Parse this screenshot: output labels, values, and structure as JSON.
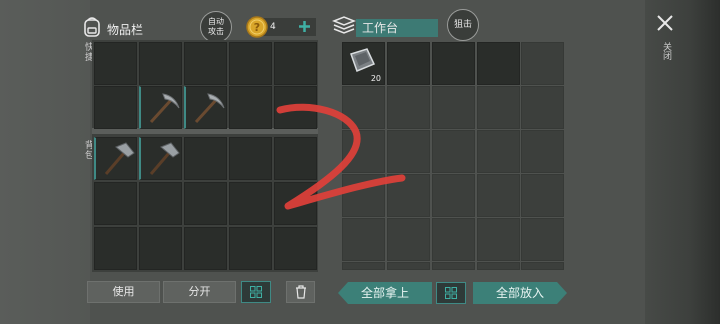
{
  "inventory": {
    "title": "物品栏",
    "auto_attack": [
      "自动",
      "攻击"
    ],
    "coins": "4",
    "quick_bar_label": "快捷",
    "backpack_label": "背包"
  },
  "workbench": {
    "title": "工作台",
    "snipe_button": "狙击",
    "close_label": "关闭",
    "slot_items": [
      {
        "name": "iron-plate",
        "count": "20"
      }
    ]
  },
  "items": {
    "quick_bar": [
      "pickaxe",
      "pickaxe"
    ],
    "backpack": [
      "hammer",
      "hammer"
    ]
  },
  "toolbar": {
    "use": "使用",
    "split": "分开",
    "take_all": "全部拿上",
    "put_all": "全部放入"
  },
  "colors": {
    "accent": "#3c8078",
    "annotation": "#e0403a"
  }
}
